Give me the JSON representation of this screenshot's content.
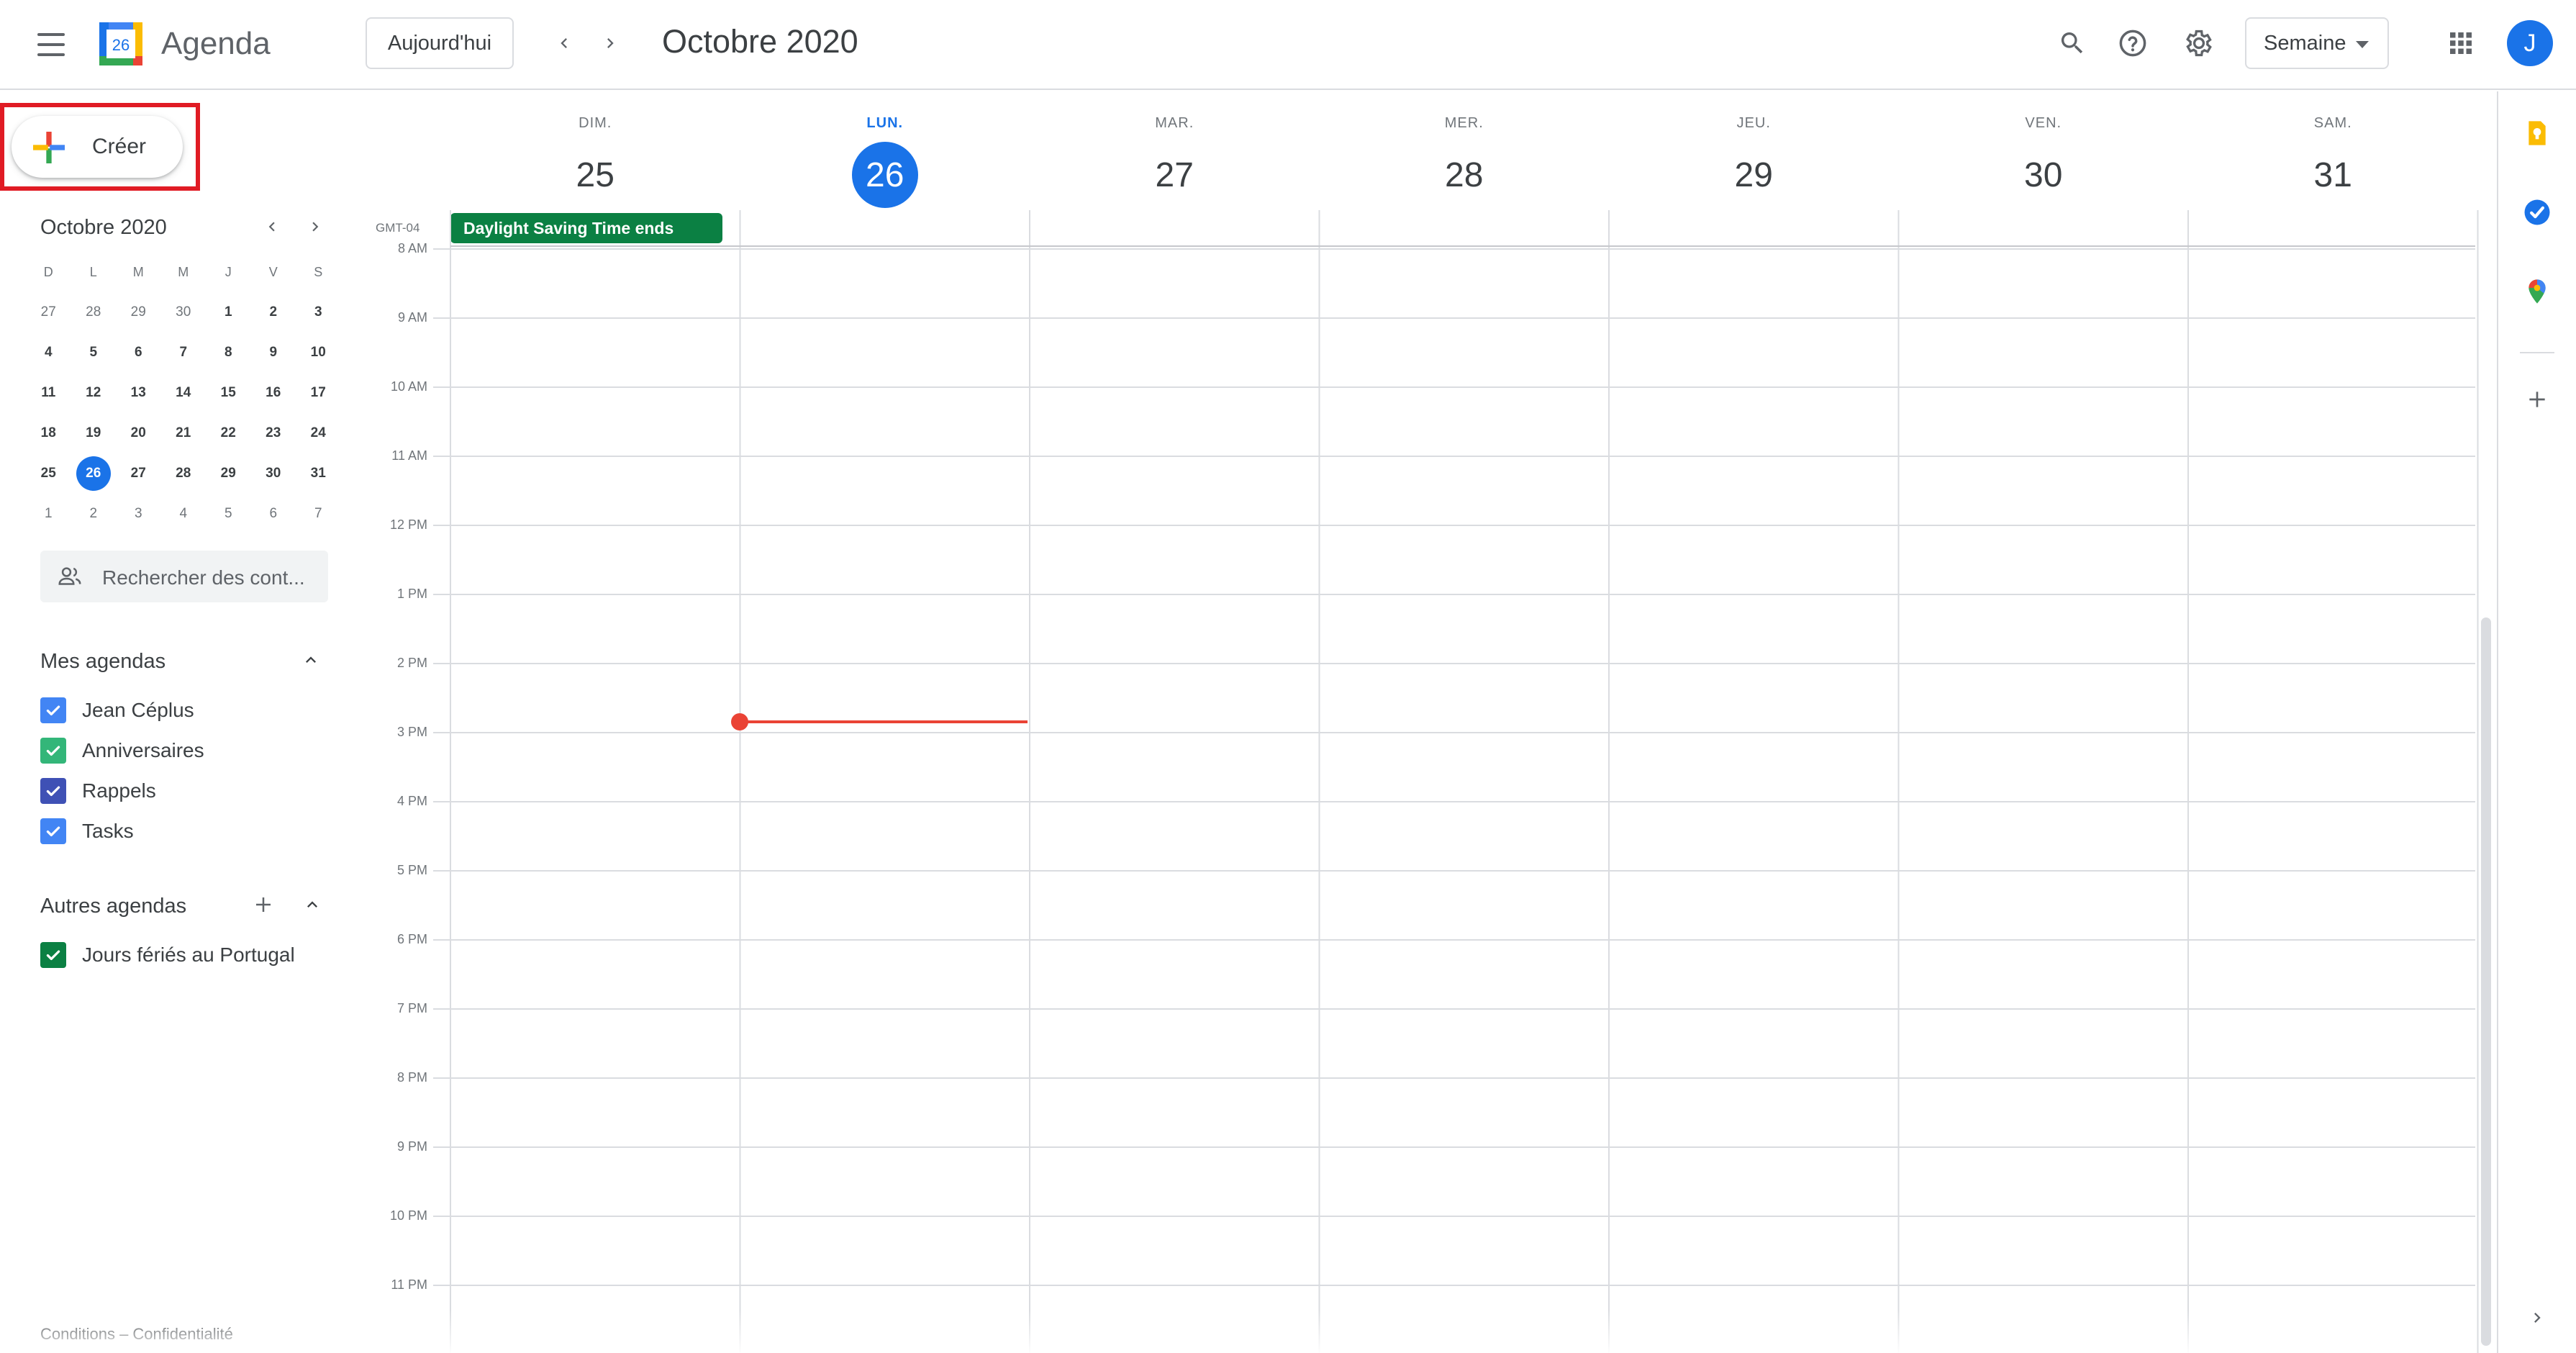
{
  "header": {
    "app_title": "Agenda",
    "logo_day": "26",
    "today_label": "Aujourd'hui",
    "month_title": "Octobre 2020",
    "view_select": "Semaine",
    "avatar_letter": "J"
  },
  "sidebar": {
    "create_label": "Créer",
    "mini_calendar": {
      "title": "Octobre 2020",
      "weekdays": [
        "D",
        "L",
        "M",
        "M",
        "J",
        "V",
        "S"
      ],
      "weeks": [
        [
          "27",
          "28",
          "29",
          "30",
          "1",
          "2",
          "3"
        ],
        [
          "4",
          "5",
          "6",
          "7",
          "8",
          "9",
          "10"
        ],
        [
          "11",
          "12",
          "13",
          "14",
          "15",
          "16",
          "17"
        ],
        [
          "18",
          "19",
          "20",
          "21",
          "22",
          "23",
          "24"
        ],
        [
          "25",
          "26",
          "27",
          "28",
          "29",
          "30",
          "31"
        ],
        [
          "1",
          "2",
          "3",
          "4",
          "5",
          "6",
          "7"
        ]
      ],
      "today": "26"
    },
    "search_placeholder": "Rechercher des cont...",
    "my_calendars": {
      "title": "Mes agendas",
      "items": [
        {
          "label": "Jean Céplus",
          "color": "#4285f4"
        },
        {
          "label": "Anniversaires",
          "color": "#33b679"
        },
        {
          "label": "Rappels",
          "color": "#3f51b5"
        },
        {
          "label": "Tasks",
          "color": "#4285f4"
        }
      ]
    },
    "other_calendars": {
      "title": "Autres agendas",
      "items": [
        {
          "label": "Jours fériés au Portugal",
          "color": "#0b8043"
        }
      ]
    },
    "footer": "Conditions – Confidentialité"
  },
  "week": {
    "timezone": "GMT-04",
    "days": [
      {
        "dow": "DIM.",
        "num": "25",
        "today": false
      },
      {
        "dow": "LUN.",
        "num": "26",
        "today": true
      },
      {
        "dow": "MAR.",
        "num": "27",
        "today": false
      },
      {
        "dow": "MER.",
        "num": "28",
        "today": false
      },
      {
        "dow": "JEU.",
        "num": "29",
        "today": false
      },
      {
        "dow": "VEN.",
        "num": "30",
        "today": false
      },
      {
        "dow": "SAM.",
        "num": "31",
        "today": false
      }
    ],
    "allday_event": "Daylight Saving Time ends",
    "hours": [
      "8 AM",
      "9 AM",
      "10 AM",
      "11 AM",
      "12 PM",
      "1 PM",
      "2 PM",
      "3 PM",
      "4 PM",
      "5 PM",
      "6 PM",
      "7 PM",
      "8 PM",
      "9 PM",
      "10 PM",
      "11 PM"
    ]
  },
  "colors": {
    "primary": "#1a73e8",
    "now_line": "#ea4335",
    "event": "#0b8043",
    "highlight": "#e01b24"
  }
}
